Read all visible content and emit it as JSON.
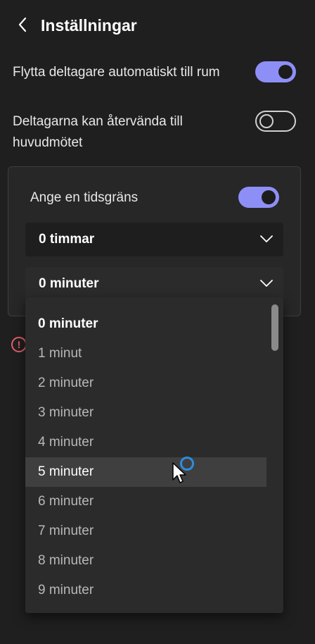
{
  "header": {
    "title": "Inställningar",
    "back_icon": "chevron-left-icon"
  },
  "settings": {
    "auto_move": {
      "label": "Flytta deltagare automatiskt till rum",
      "on": true
    },
    "return_main": {
      "label": "Deltagarna kan återvända till huvudmötet",
      "on": false
    }
  },
  "time_limit": {
    "label": "Ange en tidsgräns",
    "on": true,
    "hours_value": "0 timmar",
    "minutes_value": "0 minuter"
  },
  "dropdown": {
    "options": [
      "0 minuter",
      "1 minut",
      "2 minuter",
      "3 minuter",
      "4 minuter",
      "5 minuter",
      "6 minuter",
      "7 minuter",
      "8 minuter",
      "9 minuter"
    ],
    "selected_index": 0,
    "hover_index": 5
  },
  "colors": {
    "accent": "#8e8ff6",
    "background": "#1f1f1f",
    "error": "#e55d6a",
    "spinner": "#2d8cde"
  }
}
